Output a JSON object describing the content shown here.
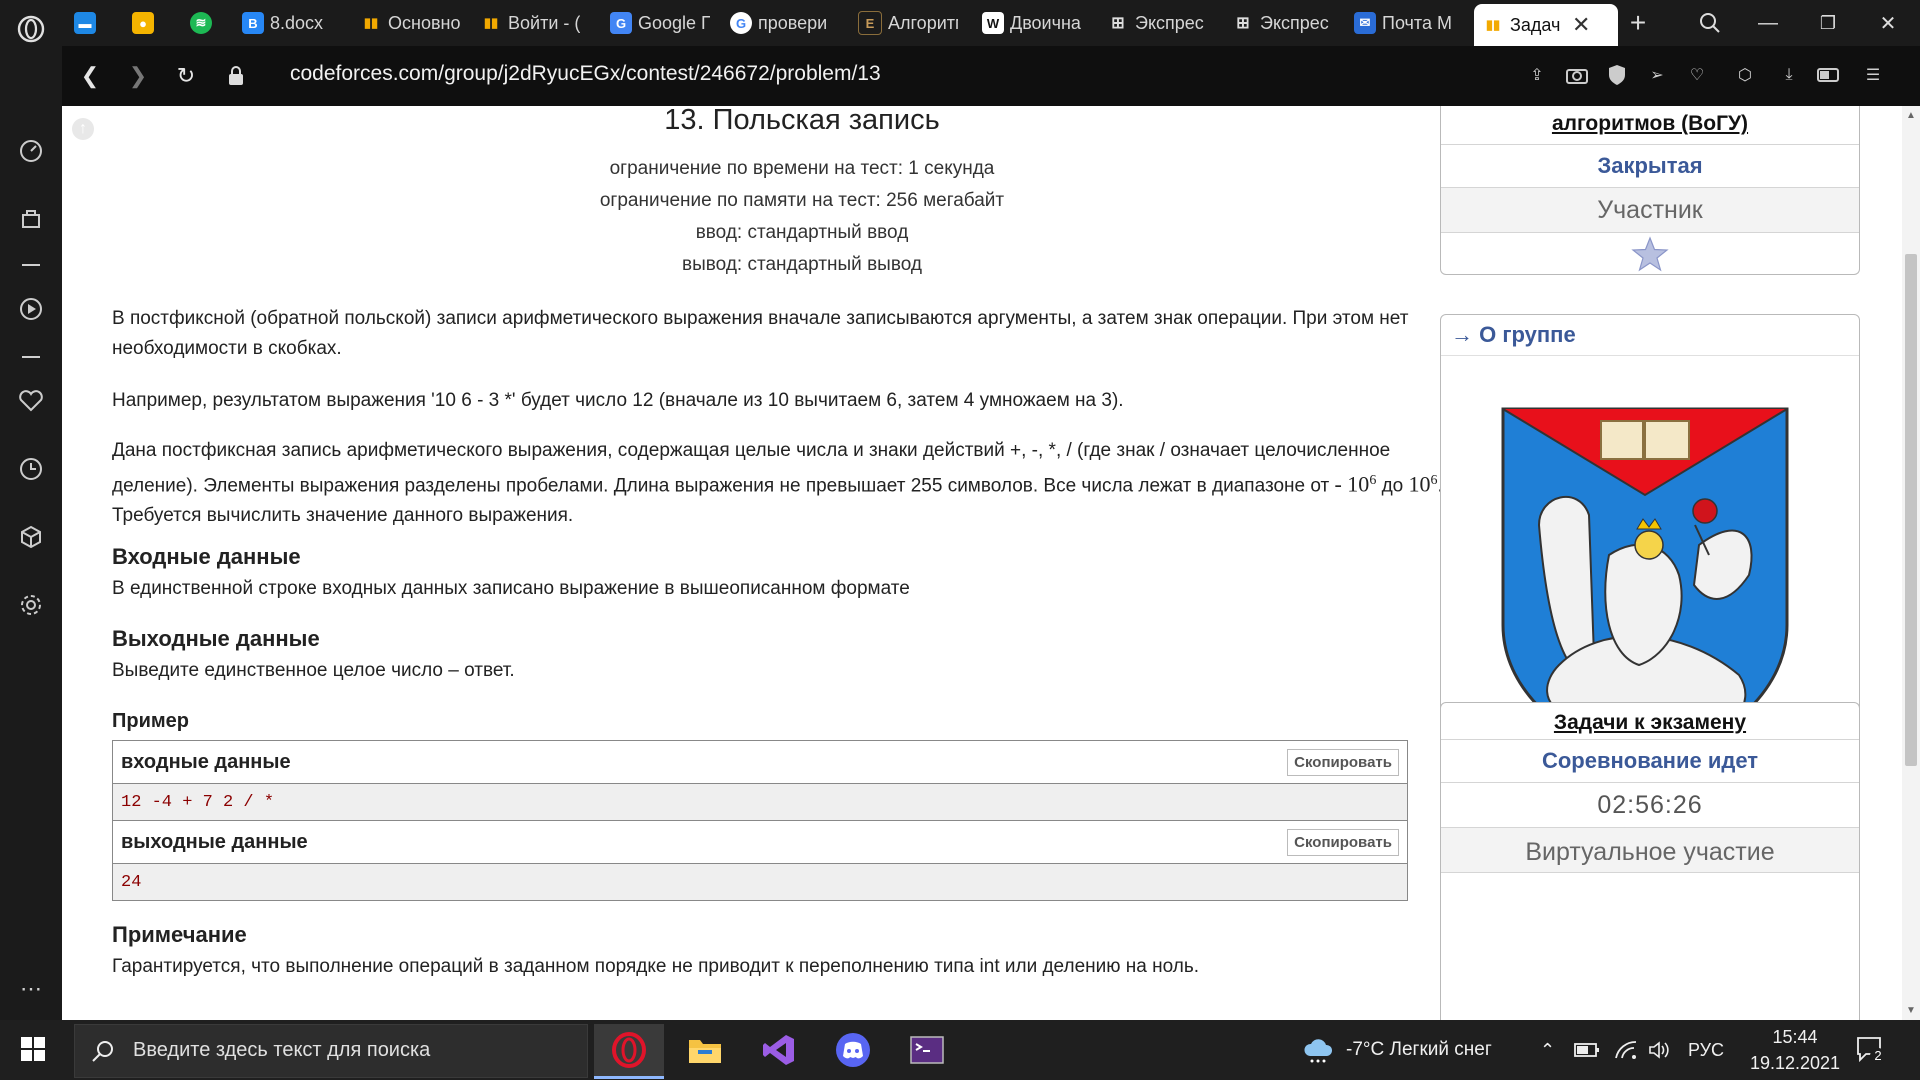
{
  "browser": {
    "tabs": [
      {
        "label": "",
        "icon": "messenger-icon",
        "color": "#1e88e5"
      },
      {
        "label": "",
        "icon": "note-icon",
        "color": "#f5b400"
      },
      {
        "label": "",
        "icon": "spotify-icon",
        "color": "#1db954"
      },
      {
        "label": "8.docx",
        "icon": "vk-icon",
        "color": "#2787f5"
      },
      {
        "label": "Основно",
        "icon": "chart-icon",
        "color": "#f2a900"
      },
      {
        "label": "Войти - (",
        "icon": "chart-icon",
        "color": "#f2a900"
      },
      {
        "label": "Google П",
        "icon": "translate-icon",
        "color": "#4285f4"
      },
      {
        "label": "провери",
        "icon": "google-icon",
        "color": "#ffffff"
      },
      {
        "label": "Алгоритм",
        "icon": "book-icon",
        "color": "#8a6d3b"
      },
      {
        "label": "Двоична",
        "icon": "wikipedia-icon",
        "color": "#ffffff"
      },
      {
        "label": "Экспрес",
        "icon": "grid-icon",
        "color": "#dddddd"
      },
      {
        "label": "Экспрес",
        "icon": "grid-icon",
        "color": "#dddddd"
      },
      {
        "label": "Почта М",
        "icon": "mail-icon",
        "color": "#2a6cd6"
      },
      {
        "label": "Задач",
        "icon": "chart-icon",
        "color": "#f2a900",
        "active": true
      }
    ],
    "url": "codeforces.com/group/j2dRyucEGx/contest/246672/problem/13"
  },
  "problem": {
    "title": "13. Польская запись",
    "limits": [
      "ограничение по времени на тест: 1 секунда",
      "ограничение по памяти на тест: 256 мегабайт",
      "ввод: стандартный ввод",
      "вывод: стандартный вывод"
    ],
    "p1": "В постфиксной (обратной польской) записи арифметического выражения вначале записываются аргументы, а затем знак операции. При этом нет необходимости в скобках.",
    "p2": "Например, результатом выражения '10 6 - 3 *' будет число 12 (вначале из 10 вычитаем 6, затем 4 умножаем на 3).",
    "p3a": "Дана постфиксная запись арифметического выражения, содержащая целые числа и знаки действий +, -, *, / (где знак / означает целочисленное деление). Элементы выражения разделены пробелами. Длина выражения не превышает 255 символов. Все числа лежат в диапазоне от ",
    "p3_from": "- 10",
    "p3_exp": "6",
    "p3_mid": " до ",
    "p3_to": "10",
    "p3b": ". Требуется вычислить значение данного выражения.",
    "input_heading": "Входные данные",
    "input_text": "В единственной строке входных данных записано выражение в вышеописанном формате",
    "output_heading": "Выходные данные",
    "output_text": "Выведите единственное целое число – ответ.",
    "example_heading": "Пример",
    "sample_input_label": "входные  данные",
    "sample_input": "12 -4 + 7 2 / *",
    "sample_output_label": "выходные  данные",
    "sample_output": "24",
    "copy_label": "Скопировать",
    "note_heading": "Примечание",
    "note_text": "Гарантируется, что выполнение операций в заданном порядке не приводит к переполнению типа int или делению на ноль."
  },
  "right": {
    "group_name_tail": "алгоритмов (ВоГУ)",
    "closed": "Закрытая",
    "role": "Участник",
    "about_link": "→ О группе",
    "contest_name": "Задачи к экзамену",
    "contest_status": "Соревнование идет",
    "timer": "02:56:26",
    "virtual": "Виртуальное участие"
  },
  "taskbar": {
    "search_placeholder": "Введите здесь текст для поиска",
    "weather": "-7°C  Легкий снег",
    "lang": "РУС",
    "time": "15:44",
    "date": "19.12.2021",
    "notifications": "2"
  }
}
